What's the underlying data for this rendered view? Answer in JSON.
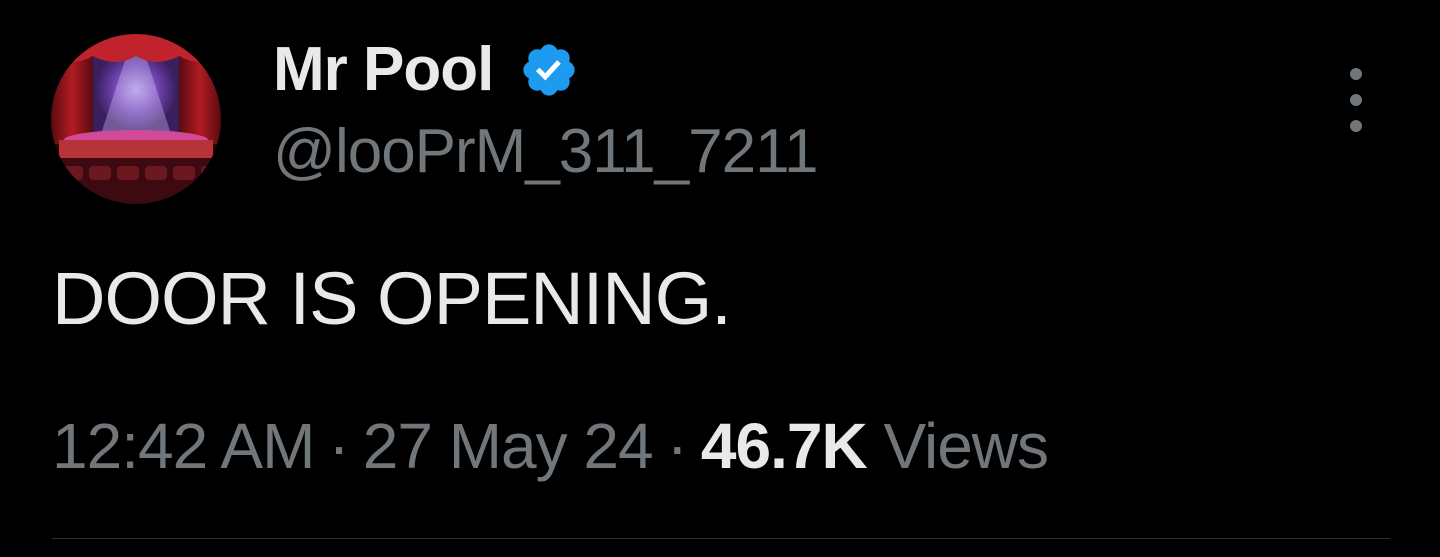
{
  "author": {
    "display_name": "Mr Pool",
    "handle": "@looPrM_311_7211",
    "verified": true,
    "avatar_icon": "theater-stage-avatar"
  },
  "tweet": {
    "text": "DOOR IS OPENING."
  },
  "meta": {
    "time": "12:42 AM",
    "separator": "·",
    "date": "27 May 24",
    "views_count": "46.7K",
    "views_label": "Views"
  },
  "colors": {
    "background": "#000000",
    "primary_text": "#e7e9ea",
    "secondary_text": "#71767b",
    "verified_badge": "#1d9bf0",
    "divider": "#2f3336"
  }
}
